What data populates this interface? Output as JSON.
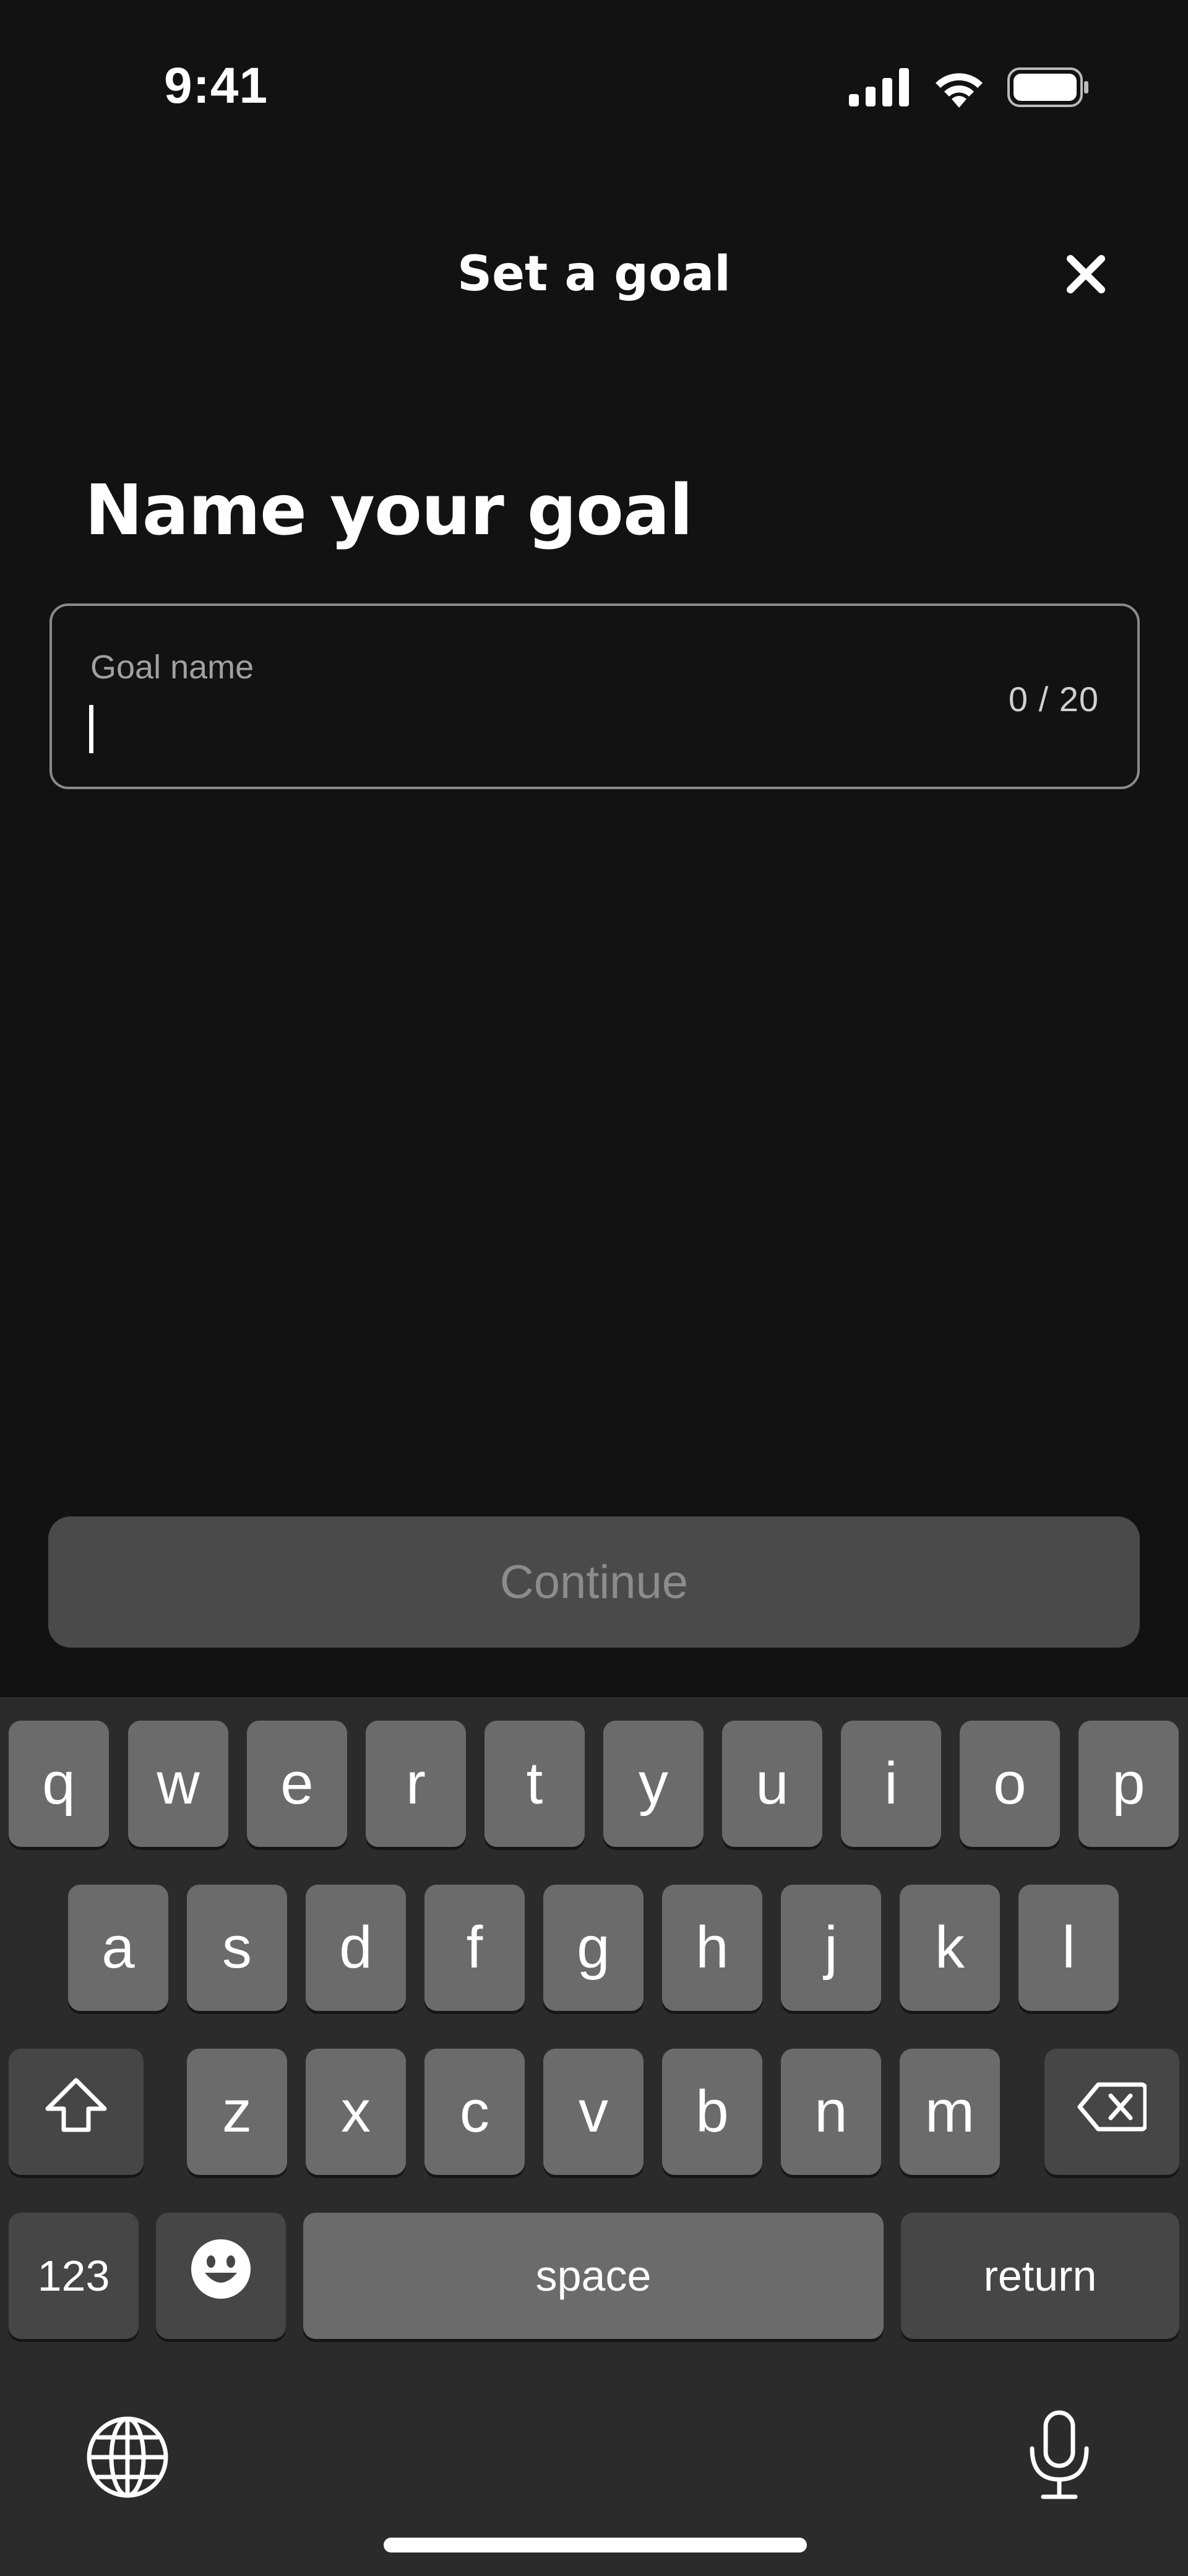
{
  "status_bar": {
    "time": "9:41",
    "icons": [
      "signal-icon",
      "wifi-icon",
      "battery-icon"
    ]
  },
  "header": {
    "title": "Set a goal",
    "close_icon": "close-icon"
  },
  "main": {
    "heading": "Name your goal",
    "goal_field": {
      "label": "Goal name",
      "value": "",
      "counter": "0 / 20"
    },
    "continue_label": "Continue"
  },
  "keyboard": {
    "row1": [
      "q",
      "w",
      "e",
      "r",
      "t",
      "y",
      "u",
      "i",
      "o",
      "p"
    ],
    "row2": [
      "a",
      "s",
      "d",
      "f",
      "g",
      "h",
      "j",
      "k",
      "l"
    ],
    "row3": [
      "z",
      "x",
      "c",
      "v",
      "b",
      "n",
      "m"
    ],
    "numbers_label": "123",
    "space_label": "space",
    "return_label": "return",
    "icons": [
      "shift-icon",
      "delete-icon",
      "emoji-icon",
      "globe-icon",
      "microphone-icon"
    ]
  },
  "colors": {
    "background": "#121212",
    "keyboard_background": "#2b2b2b",
    "key": "#6b6b6b",
    "key_dark": "#464646",
    "button_disabled": "#4a4a4a"
  }
}
